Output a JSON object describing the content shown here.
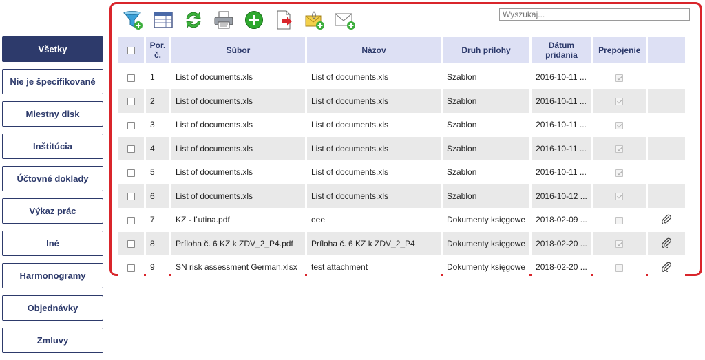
{
  "sidebar": {
    "items": [
      {
        "label": "Všetky",
        "active": true
      },
      {
        "label": "Nie je špecifikované",
        "active": false
      },
      {
        "label": "Miestny disk",
        "active": false
      },
      {
        "label": "Inštitúcia",
        "active": false
      },
      {
        "label": "Účtovné doklady",
        "active": false
      },
      {
        "label": "Výkaz prác",
        "active": false
      },
      {
        "label": "Iné",
        "active": false
      },
      {
        "label": "Harmonogramy",
        "active": false
      },
      {
        "label": "Objednávky",
        "active": false
      },
      {
        "label": "Zmluvy",
        "active": false
      }
    ]
  },
  "toolbar": {
    "icons": [
      "add-filter-icon",
      "table-columns-icon",
      "refresh-icon",
      "print-icon",
      "add-icon",
      "export-icon",
      "add-mail-attachment-icon",
      "add-mail-icon"
    ]
  },
  "search": {
    "placeholder": "Wyszukaj..."
  },
  "table": {
    "headers": {
      "no": "Por. č.",
      "file": "Súbor",
      "name": "Názov",
      "type": "Druh prílohy",
      "date": "Dátum pridania",
      "link": "Prepojenie"
    },
    "rows": [
      {
        "no": "1",
        "file": "List of documents.xls",
        "name": "List of documents.xls",
        "type": "Szablon",
        "date": "2016-10-11 ...",
        "linked": true,
        "attachment": false
      },
      {
        "no": "2",
        "file": "List of documents.xls",
        "name": "List of documents.xls",
        "type": "Szablon",
        "date": "2016-10-11 ...",
        "linked": true,
        "attachment": false
      },
      {
        "no": "3",
        "file": "List of documents.xls",
        "name": "List of documents.xls",
        "type": "Szablon",
        "date": "2016-10-11 ...",
        "linked": true,
        "attachment": false
      },
      {
        "no": "4",
        "file": "List of documents.xls",
        "name": "List of documents.xls",
        "type": "Szablon",
        "date": "2016-10-11 ...",
        "linked": true,
        "attachment": false
      },
      {
        "no": "5",
        "file": "List of documents.xls",
        "name": "List of documents.xls",
        "type": "Szablon",
        "date": "2016-10-11 ...",
        "linked": true,
        "attachment": false
      },
      {
        "no": "6",
        "file": "List of documents.xls",
        "name": "List of documents.xls",
        "type": "Szablon",
        "date": "2016-10-12 ...",
        "linked": true,
        "attachment": false
      },
      {
        "no": "7",
        "file": "KZ - Ľutina.pdf",
        "name": "eee",
        "type": "Dokumenty księgowe",
        "date": "2018-02-09 ...",
        "linked": false,
        "attachment": true
      },
      {
        "no": "8",
        "file": "Príloha č. 6 KZ k ZDV_2_P4.pdf",
        "name": "Príloha č. 6 KZ k ZDV_2_P4",
        "type": "Dokumenty księgowe",
        "date": "2018-02-20 ...",
        "linked": true,
        "attachment": true
      },
      {
        "no": "9",
        "file": "SN risk assessment German.xlsx",
        "name": "test attachment",
        "type": "Dokumenty księgowe",
        "date": "2018-02-20 ...",
        "linked": false,
        "attachment": true
      }
    ]
  }
}
